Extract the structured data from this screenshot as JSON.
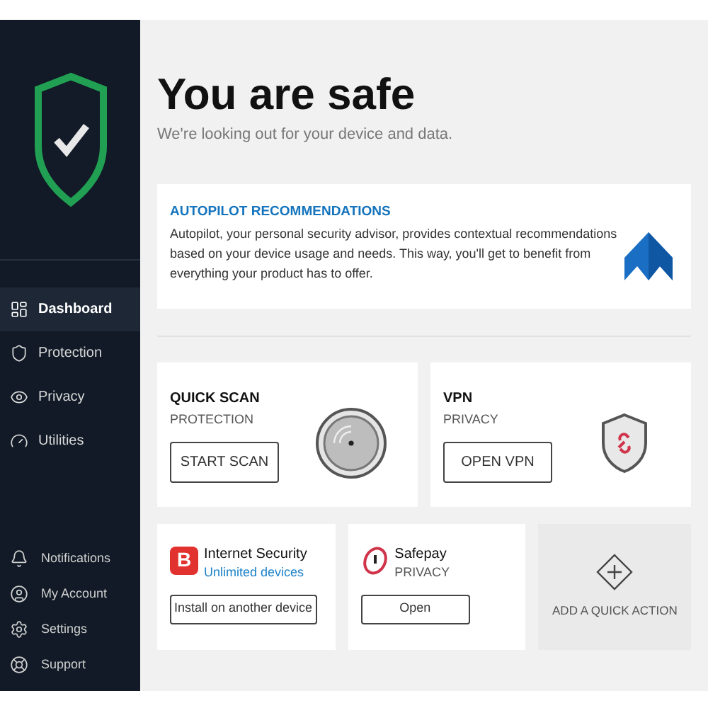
{
  "sidebar": {
    "nav": [
      {
        "label": "Dashboard",
        "selected": true
      },
      {
        "label": "Protection",
        "selected": false
      },
      {
        "label": "Privacy",
        "selected": false
      },
      {
        "label": "Utilities",
        "selected": false
      }
    ],
    "footer": [
      {
        "label": "Notifications"
      },
      {
        "label": "My Account"
      },
      {
        "label": "Settings"
      },
      {
        "label": "Support"
      }
    ]
  },
  "header": {
    "title": "You are safe",
    "subtitle": "We're looking out for your device and data."
  },
  "autopilot": {
    "title": "AUTOPILOT RECOMMENDATIONS",
    "text": "Autopilot, your personal security advisor, provides contextual recommendations based on your device usage and needs. This way, you'll get to benefit from everything your product has to offer."
  },
  "actions": [
    {
      "kind": "scan",
      "title": "QUICK SCAN",
      "category": "PROTECTION",
      "button": "START SCAN"
    },
    {
      "kind": "vpn",
      "title": "VPN",
      "category": "PRIVACY",
      "button": "OPEN VPN"
    },
    {
      "kind": "product",
      "logo_letter": "B",
      "title": "Internet Security",
      "category": "Unlimited devices",
      "button": "Install on another device"
    },
    {
      "kind": "safepay",
      "title": "Safepay",
      "category": "PRIVACY",
      "button": "Open"
    },
    {
      "kind": "add",
      "label": "ADD A QUICK ACTION"
    }
  ]
}
